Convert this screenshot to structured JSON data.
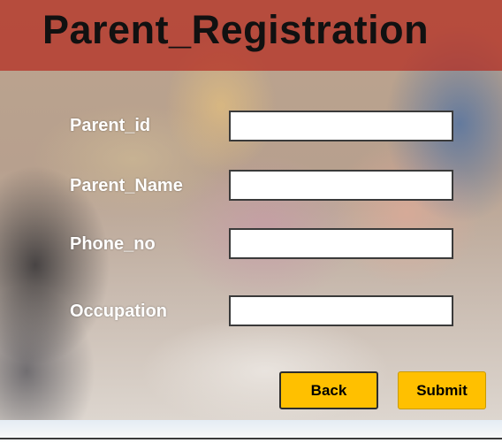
{
  "header": {
    "title": "Parent_Registration"
  },
  "form": {
    "fields": [
      {
        "label": "Parent_id",
        "value": "",
        "placeholder": ""
      },
      {
        "label": "Parent_Name",
        "value": "",
        "placeholder": ""
      },
      {
        "label": "Phone_no",
        "value": "",
        "placeholder": ""
      },
      {
        "label": "Occupation",
        "value": "",
        "placeholder": ""
      }
    ]
  },
  "buttons": {
    "back_label": "Back",
    "submit_label": "Submit"
  },
  "colors": {
    "header_band": "#b42a1e",
    "button_fill": "#ffc000",
    "title_text": "#111111",
    "label_text": "#ffffff"
  }
}
